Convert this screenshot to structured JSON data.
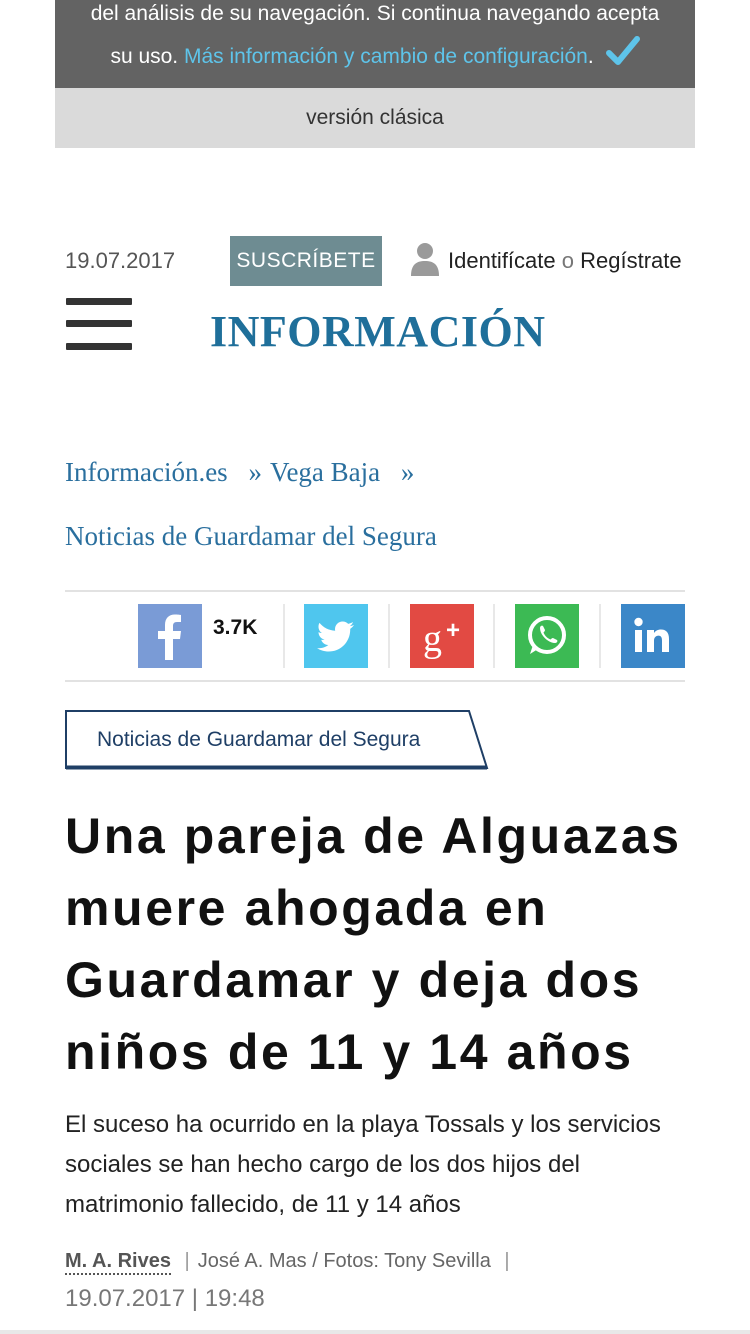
{
  "cookie_banner": {
    "line1": "del análisis de su navegación. Si continua navegando acepta",
    "line2_prefix": "su uso.",
    "link": "Más información y cambio de configuración",
    "line2_suffix": ".",
    "accept_icon": "checkmark-icon",
    "classic_version": "versión clásica"
  },
  "header": {
    "date": "19.07.2017",
    "subscribe_label": "SUSCRÍBETE",
    "login_label": "Identifícate",
    "login_or": "o",
    "register_label": "Regístrate",
    "user_icon": "user-icon",
    "menu_icon": "hamburger-icon",
    "logo_text": "INFORMACIÓN",
    "brand_color": "#1f6f9a"
  },
  "breadcrumb": {
    "home": "Información.es",
    "sep1": "»",
    "section": "Vega Baja",
    "sep2": "»",
    "subsection": "Noticias de Guardamar del Segura"
  },
  "share": {
    "facebook": {
      "icon": "facebook-icon",
      "count": "3.7K",
      "color": "#7a9bd6"
    },
    "twitter": {
      "icon": "twitter-icon",
      "color": "#4fc6ee"
    },
    "googleplus": {
      "icon": "google-plus-icon",
      "color": "#e24a43"
    },
    "whatsapp": {
      "icon": "whatsapp-icon",
      "color": "#3cba54"
    },
    "linkedin": {
      "icon": "linkedin-icon",
      "color": "#3b87c8"
    }
  },
  "article": {
    "section_tag": "Noticias de Guardamar del Segura",
    "headline": "Una pareja de Alguazas muere ahogada en Guardamar y deja dos niños de 11 y 14 años",
    "lead": "El suceso ha ocurrido en la playa Tossals y los servicios sociales se han hecho cargo de los dos hijos del matrimonio fallecido, de 11 y 14 años",
    "author": "M. A. Rives",
    "credits": "José A. Mas / Fotos: Tony Sevilla",
    "date": "19.07.2017",
    "time": "19:48"
  }
}
